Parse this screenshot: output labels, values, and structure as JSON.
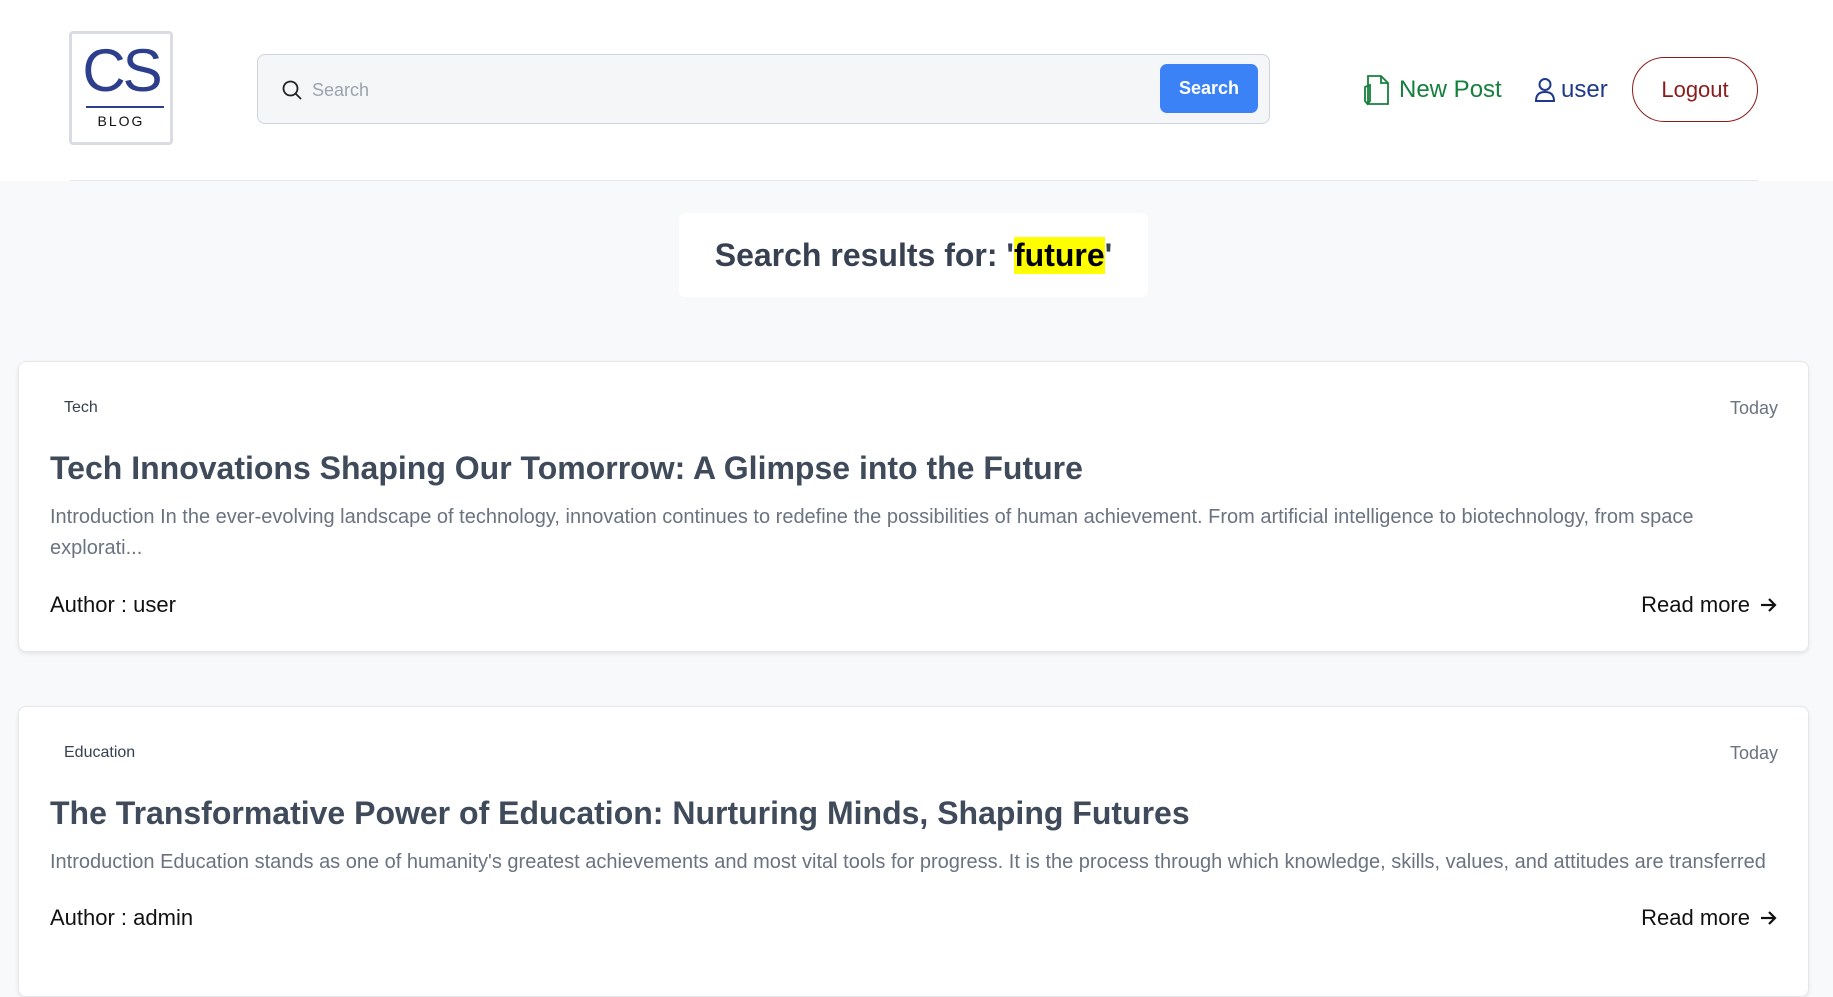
{
  "header": {
    "logo": {
      "main": "CS",
      "sub": "BLOG"
    },
    "search": {
      "placeholder": "Search",
      "button_label": "Search"
    },
    "nav": {
      "new_post_label": "New Post",
      "user_label": "user",
      "logout_label": "Logout"
    }
  },
  "results": {
    "prefix": "Search results for: '",
    "query": "future",
    "suffix": "'"
  },
  "posts": [
    {
      "category": "Tech",
      "date": "Today",
      "title": "Tech Innovations Shaping Our Tomorrow: A Glimpse into the Future",
      "excerpt": "Introduction In the ever-evolving landscape of technology, innovation continues to redefine the possibilities of human achievement. From artificial intelligence to biotechnology, from space explorati...",
      "author": "Author : user",
      "read_more": "Read more"
    },
    {
      "category": "Education",
      "date": "Today",
      "title": "The Transformative Power of Education: Nurturing Minds, Shaping Futures",
      "excerpt": "Introduction Education stands as one of humanity's greatest achievements and most vital tools for progress. It is the process through which knowledge, skills, values, and attitudes are transferred fr...",
      "author": "Author : admin",
      "read_more": "Read more"
    }
  ],
  "colors": {
    "primary_button": "#3b82f6",
    "new_post": "#15803d",
    "user_link": "#1e3a8a",
    "logout": "#8b1c1c",
    "highlight": "#ffff00"
  },
  "icons": {
    "search": "search-icon",
    "new_post": "document-pen-icon",
    "user": "user-icon",
    "read_more": "arrow-right-icon"
  }
}
